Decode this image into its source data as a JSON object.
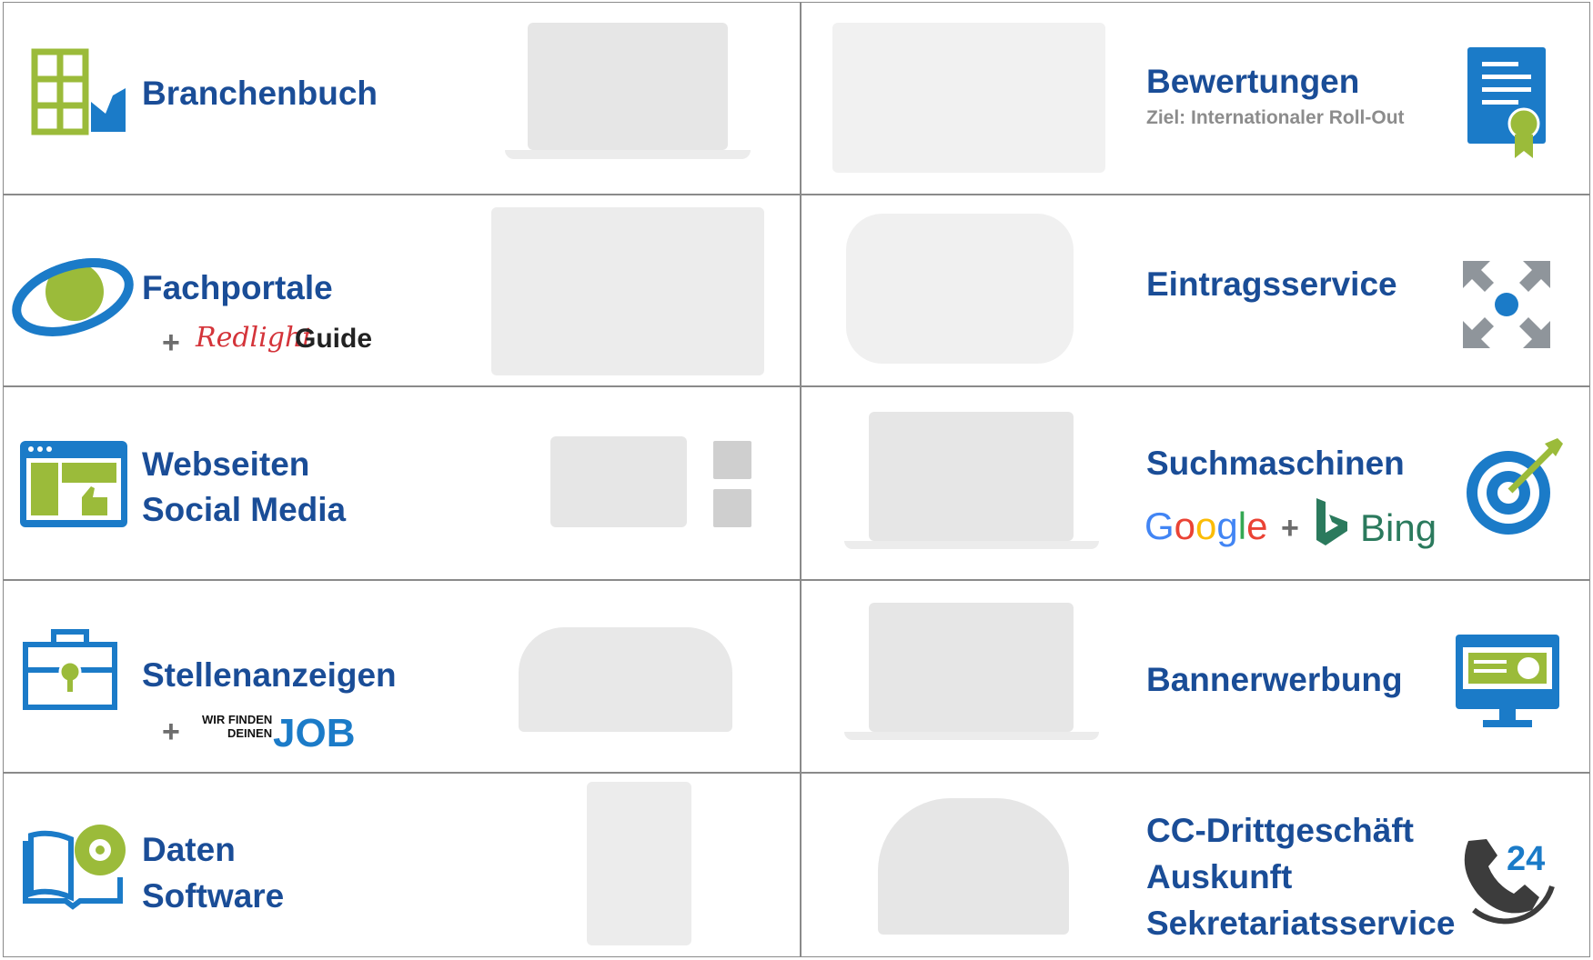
{
  "services": [
    {
      "title": "Branchenbuch"
    },
    {
      "title": "Bewertungen",
      "subtitle": "Ziel: Internationaler Roll-Out"
    },
    {
      "title": "Fachportale",
      "partner_plus": "+",
      "partner_script": "Redlight",
      "partner_bold": "Guide"
    },
    {
      "title": "Eintragsservice"
    },
    {
      "title_line1": "Webseiten",
      "title_line2": "Social Media"
    },
    {
      "title": "Suchmaschinen",
      "google": "Google",
      "plus": "+",
      "bing": "Bing"
    },
    {
      "title": "Stellenanzeigen",
      "partner_plus": "+",
      "partner_line1": "WIR FINDEN",
      "partner_line2": "DEINEN",
      "partner_job": "JOB"
    },
    {
      "title": "Bannerwerbung"
    },
    {
      "title_line1": "Daten",
      "title_line2": "Software"
    },
    {
      "title_line1": "CC-Drittgeschäft",
      "title_line2": "Auskunft",
      "title_line3": "Sekretariatsservice"
    }
  ],
  "colors": {
    "title": "#1a4d97",
    "accent_green": "#9bbb3a",
    "accent_blue": "#1b7bc8",
    "border": "#8a8a8a"
  }
}
